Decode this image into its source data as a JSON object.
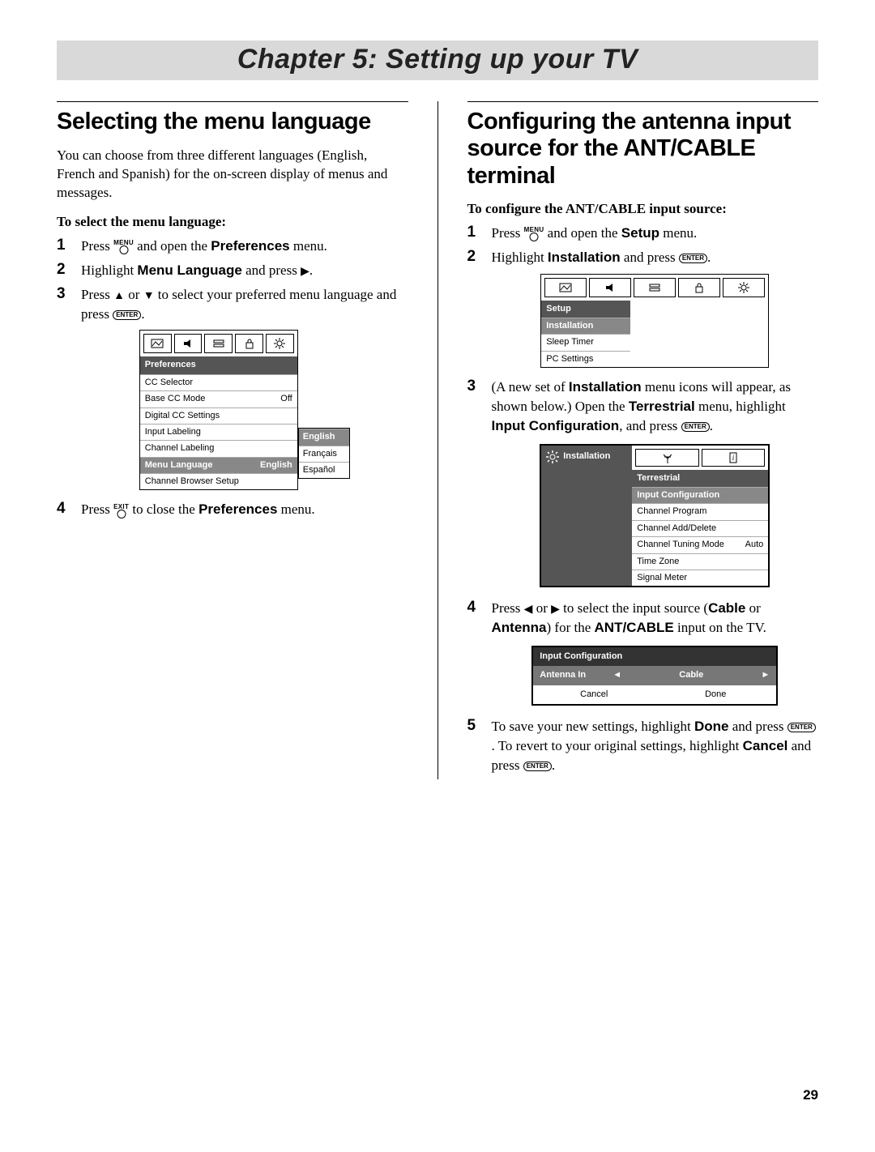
{
  "chapter": {
    "title": "Chapter 5: Setting up your TV"
  },
  "page_number": "29",
  "left": {
    "heading": "Selecting the menu language",
    "intro": "You can choose from three different languages (English, French and Spanish) for the on-screen display of menus and messages.",
    "subhead": "To select the menu language:",
    "steps": {
      "s1a": "Press ",
      "s1_key": "MENU",
      "s1b": " and open the ",
      "s1_bold": "Preferences",
      "s1c": " menu.",
      "s2a": "Highlight ",
      "s2_bold": "Menu Language",
      "s2b": " and press ",
      "s3a": "Press ",
      "s3b": " or ",
      "s3c": " to select your preferred menu language and press ",
      "s3_enter": "ENTER",
      "s4a": "Press ",
      "s4_key": "EXIT",
      "s4b": " to close the ",
      "s4_bold": "Preferences",
      "s4c": " menu."
    },
    "fig": {
      "panel": "Preferences",
      "rows": [
        {
          "label": "CC Selector",
          "val": ""
        },
        {
          "label": "Base CC Mode",
          "val": "Off"
        },
        {
          "label": "Digital CC Settings",
          "val": ""
        },
        {
          "label": "Input Labeling",
          "val": ""
        },
        {
          "label": "Channel Labeling",
          "val": ""
        },
        {
          "label": "Menu Language",
          "val": "English",
          "sel": true
        },
        {
          "label": "Channel Browser Setup",
          "val": ""
        }
      ],
      "dropdown": [
        "English",
        "Français",
        "Español"
      ]
    }
  },
  "right": {
    "heading": "Configuring the antenna input source for the ANT/CABLE terminal",
    "subhead": "To configure the ANT/CABLE input source:",
    "steps": {
      "s1a": "Press ",
      "s1_key": "MENU",
      "s1b": " and open the ",
      "s1_bold": "Setup",
      "s1c": " menu.",
      "s2a": "Highlight ",
      "s2_bold": "Installation",
      "s2b": " and press ",
      "s2_enter": "ENTER",
      "s3a": "(A new set of ",
      "s3_bold1": "Installation",
      "s3b": " menu icons will appear, as shown below.) Open the ",
      "s3_bold2": "Terrestrial",
      "s3c": " menu, highlight ",
      "s3_bold3": "Input Configuration",
      "s3d": ", and press ",
      "s3_enter": "ENTER",
      "s4a": "Press ",
      "s4b": " or ",
      "s4c": " to select the input source (",
      "s4_bold1": "Cable",
      "s4d": " or ",
      "s4_bold2": "Antenna",
      "s4e": ") for the ",
      "s4_bold3": "ANT/CABLE",
      "s4f": " input on the TV.",
      "s5a": "To save your new settings, highlight ",
      "s5_bold1": "Done",
      "s5b": " and press ",
      "s5_enter": "ENTER",
      "s5c": ". To revert to your original settings, highlight ",
      "s5_bold2": "Cancel",
      "s5d": " and press ",
      "s5_enter2": "ENTER",
      "s5e": "."
    },
    "fig_setup": {
      "panel": "Setup",
      "rows": [
        {
          "label": "Installation",
          "sel": true
        },
        {
          "label": "Sleep Timer"
        },
        {
          "label": "PC Settings"
        }
      ]
    },
    "fig_install": {
      "left_label": "Installation",
      "panel": "Terrestrial",
      "rows": [
        {
          "label": "Input Configuration",
          "sel": true
        },
        {
          "label": "Channel Program"
        },
        {
          "label": "Channel Add/Delete"
        },
        {
          "label": "Channel Tuning Mode",
          "val": "Auto"
        },
        {
          "label": "Time Zone"
        },
        {
          "label": "Signal Meter"
        }
      ]
    },
    "fig_input": {
      "panel": "Input Configuration",
      "row_label": "Antenna In",
      "row_value": "Cable",
      "btn_cancel": "Cancel",
      "btn_done": "Done"
    }
  }
}
